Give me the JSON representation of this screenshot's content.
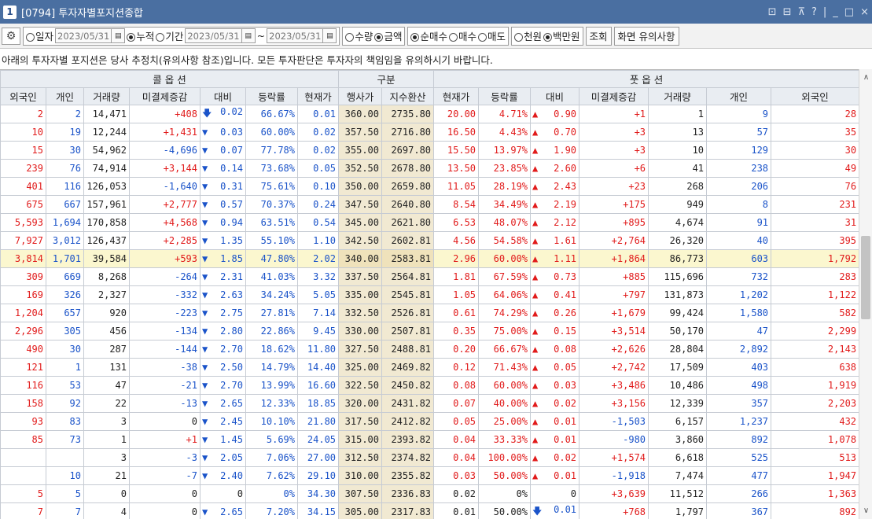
{
  "window": {
    "number": "1",
    "title": "[0794] 투자자별포지션종합",
    "controls": [
      "⊡",
      "⊟",
      "⊼",
      "?",
      "|",
      "_",
      "□",
      "×"
    ]
  },
  "toolbar": {
    "radio_daily": "일자",
    "date_daily": "2023/05/31",
    "radio_cumulative": "누적",
    "radio_period": "기간",
    "date_from": "2023/05/31",
    "tilde": "~",
    "date_to": "2023/05/31",
    "radio_quantity": "수량",
    "radio_amount": "금액",
    "radio_net_buy": "순매수",
    "radio_buy": "매수",
    "radio_sell": "매도",
    "radio_won": "천원",
    "radio_million": "백만원",
    "search_label": "조회",
    "notes_label": "화면 유의사항"
  },
  "notice": "아래의 투자자별 포지션은 당사 추정치(유의사항 참조)입니다. 모든 투자판단은 투자자의 책임임을 유의하시기 바랍니다.",
  "table": {
    "group_headers": {
      "call": "콜 옵 션",
      "mid": "구분",
      "put": "풋 옵 션"
    },
    "columns": {
      "call": [
        "외국인",
        "개인",
        "거래량",
        "미결제증감",
        "대비",
        "등락률",
        "현재가"
      ],
      "mid": [
        "행사가",
        "지수환산"
      ],
      "put": [
        "현재가",
        "등락률",
        "대비",
        "미결제증감",
        "거래량",
        "개인",
        "외국인"
      ]
    },
    "colors": {
      "red": "#e11b1b",
      "blue": "#1a53c9",
      "mid_bg": "#f1e9d2",
      "highlight_bg": "#fbf7cf"
    },
    "highlight_row": 8,
    "rows": [
      {
        "cf": "2",
        "cp": "2",
        "cv": "14,471",
        "coi": "+408",
        "cd": "0.02",
        "cdir": "down-arrow",
        "cr": "66.67%",
        "cpr": "0.01",
        "strike": "360.00",
        "idx": "2735.80",
        "ppr": "20.00",
        "pr": "4.71%",
        "pdir": "up",
        "pd": "0.90",
        "poi": "+1",
        "pv": "1",
        "pp": "9",
        "pf": "28"
      },
      {
        "cf": "10",
        "cp": "19",
        "cv": "12,244",
        "coi": "+1,431",
        "cd": "0.03",
        "cdir": "down",
        "cr": "60.00%",
        "cpr": "0.02",
        "strike": "357.50",
        "idx": "2716.80",
        "ppr": "16.50",
        "pr": "4.43%",
        "pdir": "up",
        "pd": "0.70",
        "poi": "+3",
        "pv": "13",
        "pp": "57",
        "pf": "35"
      },
      {
        "cf": "15",
        "cp": "30",
        "cv": "54,962",
        "coi": "-4,696",
        "cd": "0.07",
        "cdir": "down",
        "cr": "77.78%",
        "cpr": "0.02",
        "strike": "355.00",
        "idx": "2697.80",
        "ppr": "15.50",
        "pr": "13.97%",
        "pdir": "up",
        "pd": "1.90",
        "poi": "+3",
        "pv": "10",
        "pp": "129",
        "pf": "30"
      },
      {
        "cf": "239",
        "cp": "76",
        "cv": "74,914",
        "coi": "+3,144",
        "cd": "0.14",
        "cdir": "down",
        "cr": "73.68%",
        "cpr": "0.05",
        "strike": "352.50",
        "idx": "2678.80",
        "ppr": "13.50",
        "pr": "23.85%",
        "pdir": "up",
        "pd": "2.60",
        "poi": "+6",
        "pv": "41",
        "pp": "238",
        "pf": "49"
      },
      {
        "cf": "401",
        "cp": "116",
        "cv": "126,053",
        "coi": "-1,640",
        "cd": "0.31",
        "cdir": "down",
        "cr": "75.61%",
        "cpr": "0.10",
        "strike": "350.00",
        "idx": "2659.80",
        "ppr": "11.05",
        "pr": "28.19%",
        "pdir": "up",
        "pd": "2.43",
        "poi": "+23",
        "pv": "268",
        "pp": "206",
        "pf": "76"
      },
      {
        "cf": "675",
        "cp": "667",
        "cv": "157,961",
        "coi": "+2,777",
        "cd": "0.57",
        "cdir": "down",
        "cr": "70.37%",
        "cpr": "0.24",
        "strike": "347.50",
        "idx": "2640.80",
        "ppr": "8.54",
        "pr": "34.49%",
        "pdir": "up",
        "pd": "2.19",
        "poi": "+175",
        "pv": "949",
        "pp": "8",
        "pf": "231"
      },
      {
        "cf": "5,593",
        "cp": "1,694",
        "cv": "170,858",
        "coi": "+4,568",
        "cd": "0.94",
        "cdir": "down",
        "cr": "63.51%",
        "cpr": "0.54",
        "strike": "345.00",
        "idx": "2621.80",
        "ppr": "6.53",
        "pr": "48.07%",
        "pdir": "up",
        "pd": "2.12",
        "poi": "+895",
        "pv": "4,674",
        "pp": "91",
        "pf": "31"
      },
      {
        "cf": "7,927",
        "cp": "3,012",
        "cv": "126,437",
        "coi": "+2,285",
        "cd": "1.35",
        "cdir": "down",
        "cr": "55.10%",
        "cpr": "1.10",
        "strike": "342.50",
        "idx": "2602.81",
        "ppr": "4.56",
        "pr": "54.58%",
        "pdir": "up",
        "pd": "1.61",
        "poi": "+2,764",
        "pv": "26,320",
        "pp": "40",
        "pf": "395"
      },
      {
        "cf": "3,814",
        "cp": "1,701",
        "cv": "39,584",
        "coi": "+593",
        "cd": "1.85",
        "cdir": "down",
        "cr": "47.80%",
        "cpr": "2.02",
        "strike": "340.00",
        "idx": "2583.81",
        "ppr": "2.96",
        "pr": "60.00%",
        "pdir": "up",
        "pd": "1.11",
        "poi": "+1,864",
        "pv": "86,773",
        "pp": "603",
        "pf": "1,792"
      },
      {
        "cf": "309",
        "cp": "669",
        "cv": "8,268",
        "coi": "-264",
        "cd": "2.31",
        "cdir": "down",
        "cr": "41.03%",
        "cpr": "3.32",
        "strike": "337.50",
        "idx": "2564.81",
        "ppr": "1.81",
        "pr": "67.59%",
        "pdir": "up",
        "pd": "0.73",
        "poi": "+885",
        "pv": "115,696",
        "pp": "732",
        "pf": "283"
      },
      {
        "cf": "169",
        "cp": "326",
        "cv": "2,327",
        "coi": "-332",
        "cd": "2.63",
        "cdir": "down",
        "cr": "34.24%",
        "cpr": "5.05",
        "strike": "335.00",
        "idx": "2545.81",
        "ppr": "1.05",
        "pr": "64.06%",
        "pdir": "up",
        "pd": "0.41",
        "poi": "+797",
        "pv": "131,873",
        "pp": "1,202",
        "pf": "1,122"
      },
      {
        "cf": "1,204",
        "cp": "657",
        "cv": "920",
        "coi": "-223",
        "cd": "2.75",
        "cdir": "down",
        "cr": "27.81%",
        "cpr": "7.14",
        "strike": "332.50",
        "idx": "2526.81",
        "ppr": "0.61",
        "pr": "74.29%",
        "pdir": "up",
        "pd": "0.26",
        "poi": "+1,679",
        "pv": "99,424",
        "pp": "1,580",
        "pf": "582"
      },
      {
        "cf": "2,296",
        "cp": "305",
        "cv": "456",
        "coi": "-134",
        "cd": "2.80",
        "cdir": "down",
        "cr": "22.86%",
        "cpr": "9.45",
        "strike": "330.00",
        "idx": "2507.81",
        "ppr": "0.35",
        "pr": "75.00%",
        "pdir": "up",
        "pd": "0.15",
        "poi": "+3,514",
        "pv": "50,170",
        "pp": "47",
        "pf": "2,299"
      },
      {
        "cf": "490",
        "cp": "30",
        "cv": "287",
        "coi": "-144",
        "cd": "2.70",
        "cdir": "down",
        "cr": "18.62%",
        "cpr": "11.80",
        "strike": "327.50",
        "idx": "2488.81",
        "ppr": "0.20",
        "pr": "66.67%",
        "pdir": "up",
        "pd": "0.08",
        "poi": "+2,626",
        "pv": "28,804",
        "pp": "2,892",
        "pf": "2,143"
      },
      {
        "cf": "121",
        "cp": "1",
        "cv": "131",
        "coi": "-38",
        "cd": "2.50",
        "cdir": "down",
        "cr": "14.79%",
        "cpr": "14.40",
        "strike": "325.00",
        "idx": "2469.82",
        "ppr": "0.12",
        "pr": "71.43%",
        "pdir": "up",
        "pd": "0.05",
        "poi": "+2,742",
        "pv": "17,509",
        "pp": "403",
        "pf": "638"
      },
      {
        "cf": "116",
        "cp": "53",
        "cv": "47",
        "coi": "-21",
        "cd": "2.70",
        "cdir": "down",
        "cr": "13.99%",
        "cpr": "16.60",
        "strike": "322.50",
        "idx": "2450.82",
        "ppr": "0.08",
        "pr": "60.00%",
        "pdir": "up",
        "pd": "0.03",
        "poi": "+3,486",
        "pv": "10,486",
        "pp": "498",
        "pf": "1,919"
      },
      {
        "cf": "158",
        "cp": "92",
        "cv": "22",
        "coi": "-13",
        "cd": "2.65",
        "cdir": "down",
        "cr": "12.33%",
        "cpr": "18.85",
        "strike": "320.00",
        "idx": "2431.82",
        "ppr": "0.07",
        "pr": "40.00%",
        "pdir": "up",
        "pd": "0.02",
        "poi": "+3,156",
        "pv": "12,339",
        "pp": "357",
        "pf": "2,203"
      },
      {
        "cf": "93",
        "cp": "83",
        "cv": "3",
        "coi": "0",
        "cd": "2.45",
        "cdir": "down",
        "cr": "10.10%",
        "cpr": "21.80",
        "strike": "317.50",
        "idx": "2412.82",
        "ppr": "0.05",
        "pr": "25.00%",
        "pdir": "up",
        "pd": "0.01",
        "poi": "-1,503",
        "pv": "6,157",
        "pp": "1,237",
        "pf": "432"
      },
      {
        "cf": "85",
        "cp": "73",
        "cv": "1",
        "coi": "+1",
        "cd": "1.45",
        "cdir": "down",
        "cr": "5.69%",
        "cpr": "24.05",
        "strike": "315.00",
        "idx": "2393.82",
        "ppr": "0.04",
        "pr": "33.33%",
        "pdir": "up",
        "pd": "0.01",
        "poi": "-980",
        "pv": "3,860",
        "pp": "892",
        "pf": "1,078"
      },
      {
        "cf": "",
        "cp": "",
        "cv": "3",
        "coi": "-3",
        "cd": "2.05",
        "cdir": "down",
        "cr": "7.06%",
        "cpr": "27.00",
        "strike": "312.50",
        "idx": "2374.82",
        "ppr": "0.04",
        "pr": "100.00%",
        "pdir": "up",
        "pd": "0.02",
        "poi": "+1,574",
        "pv": "6,618",
        "pp": "525",
        "pf": "513"
      },
      {
        "cf": "",
        "cp": "10",
        "cv": "21",
        "coi": "-7",
        "cd": "2.40",
        "cdir": "down",
        "cr": "7.62%",
        "cpr": "29.10",
        "strike": "310.00",
        "idx": "2355.82",
        "ppr": "0.03",
        "pr": "50.00%",
        "pdir": "up",
        "pd": "0.01",
        "poi": "-1,918",
        "pv": "7,474",
        "pp": "477",
        "pf": "1,947"
      },
      {
        "cf": "5",
        "cp": "5",
        "cv": "0",
        "coi": "0",
        "cd": "0",
        "cdir": "none",
        "cr": "0%",
        "cpr": "34.30",
        "strike": "307.50",
        "idx": "2336.83",
        "ppr": "0.02",
        "pr": "0%",
        "pdir": "none",
        "pd": "0",
        "poi": "+3,639",
        "pv": "11,512",
        "pp": "266",
        "pf": "1,363"
      },
      {
        "cf": "7",
        "cp": "7",
        "cv": "4",
        "coi": "0",
        "cd": "2.65",
        "cdir": "down",
        "cr": "7.20%",
        "cpr": "34.15",
        "strike": "305.00",
        "idx": "2317.83",
        "ppr": "0.01",
        "pr": "50.00%",
        "pdir": "down-arrow",
        "pd": "0.01",
        "poi": "+768",
        "pv": "1,797",
        "pp": "367",
        "pf": "892"
      }
    ]
  },
  "scroll": {
    "position": 0.45,
    "visible": 0.2
  }
}
